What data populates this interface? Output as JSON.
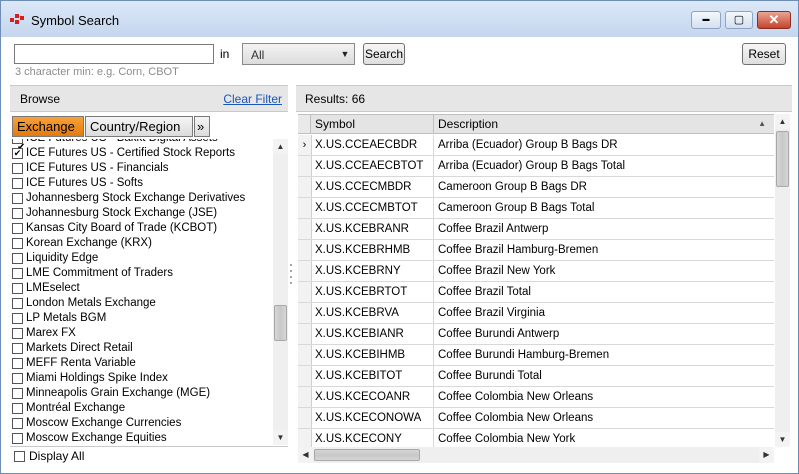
{
  "window": {
    "title": "Symbol Search",
    "minimize_glyph": "▬",
    "maximize_glyph": "▢",
    "close_glyph": "✕",
    "icon": "red-squares-app-icon"
  },
  "search": {
    "value": "",
    "placeholder": "",
    "in_label": "in",
    "hint": "3 character min: e.g. Corn, CBOT",
    "exchange_selected": "All",
    "dropdown_icon": "chevron-down-icon",
    "search_button": "Search",
    "reset_button": "Reset"
  },
  "browse": {
    "title": "Browse",
    "clear_filter": "Clear Filter",
    "tabs": [
      {
        "label": "Exchange",
        "active": true,
        "check": "✔"
      },
      {
        "label": "Country/Region",
        "active": false
      }
    ],
    "more_glyph": "»",
    "items": [
      {
        "label": "ICE Futures US - Bakkt Digital Assets",
        "checked": false
      },
      {
        "label": "ICE Futures US - Certified Stock Reports",
        "checked": true
      },
      {
        "label": "ICE Futures US - Financials",
        "checked": false
      },
      {
        "label": "ICE Futures US - Softs",
        "checked": false
      },
      {
        "label": "Johannesberg Stock Exchange Derivatives",
        "checked": false
      },
      {
        "label": "Johannesburg Stock Exchange (JSE)",
        "checked": false
      },
      {
        "label": "Kansas City Board of Trade (KCBOT)",
        "checked": false
      },
      {
        "label": "Korean Exchange (KRX)",
        "checked": false
      },
      {
        "label": "Liquidity Edge",
        "checked": false
      },
      {
        "label": "LME Commitment of Traders",
        "checked": false
      },
      {
        "label": "LMEselect",
        "checked": false
      },
      {
        "label": "London Metals Exchange",
        "checked": false
      },
      {
        "label": "LP Metals BGM",
        "checked": false
      },
      {
        "label": "Marex FX",
        "checked": false
      },
      {
        "label": "Markets Direct Retail",
        "checked": false
      },
      {
        "label": "MEFF Renta Variable",
        "checked": false
      },
      {
        "label": "Miami Holdings Spike Index",
        "checked": false
      },
      {
        "label": "Minneapolis Grain Exchange (MGE)",
        "checked": false
      },
      {
        "label": "Montréal Exchange",
        "checked": false
      },
      {
        "label": "Moscow Exchange Currencies",
        "checked": false
      },
      {
        "label": "Moscow Exchange Equities",
        "checked": false
      }
    ],
    "display_all": "Display All",
    "check_glyph": "✔"
  },
  "results": {
    "label": "Results:",
    "count": "66",
    "columns": [
      "Symbol",
      "Description"
    ],
    "sort_glyph": "▲",
    "current_marker": "›",
    "rows": [
      {
        "symbol": "X.US.CCEAECBDR",
        "description": "Arriba (Ecuador) Group B Bags DR"
      },
      {
        "symbol": "X.US.CCEAECBTOT",
        "description": "Arriba (Ecuador) Group B Bags Total"
      },
      {
        "symbol": "X.US.CCECMBDR",
        "description": "Cameroon Group B Bags DR"
      },
      {
        "symbol": "X.US.CCECMBTOT",
        "description": "Cameroon Group B Bags Total"
      },
      {
        "symbol": "X.US.KCEBRANR",
        "description": "Coffee Brazil Antwerp"
      },
      {
        "symbol": "X.US.KCEBRHMB",
        "description": "Coffee Brazil Hamburg-Bremen"
      },
      {
        "symbol": "X.US.KCEBRNY",
        "description": "Coffee Brazil New York"
      },
      {
        "symbol": "X.US.KCEBRTOT",
        "description": "Coffee Brazil Total"
      },
      {
        "symbol": "X.US.KCEBRVA",
        "description": "Coffee Brazil Virginia"
      },
      {
        "symbol": "X.US.KCEBIANR",
        "description": "Coffee Burundi Antwerp"
      },
      {
        "symbol": "X.US.KCEBIHMB",
        "description": "Coffee Burundi Hamburg-Bremen"
      },
      {
        "symbol": "X.US.KCEBITOT",
        "description": "Coffee Burundi Total"
      },
      {
        "symbol": "X.US.KCECOANR",
        "description": "Coffee Colombia New Orleans"
      },
      {
        "symbol": "X.US.KCECONOWA",
        "description": "Coffee Colombia New Orleans"
      },
      {
        "symbol": "X.US.KCECONY",
        "description": "Coffee Colombia New York"
      }
    ]
  },
  "colors": {
    "accent_orange": "#f08a1c",
    "link_blue": "#1a56b8",
    "title_bar": "#c4d6ee",
    "close_red": "#c6432c"
  }
}
